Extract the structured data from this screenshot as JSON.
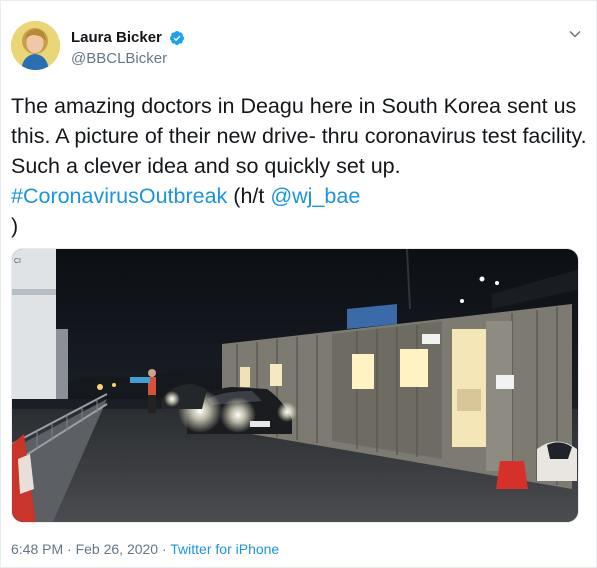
{
  "tweet": {
    "author": {
      "display_name": "Laura Bicker",
      "handle": "@BBCLBicker",
      "verified_icon": "verified-badge-icon"
    },
    "menu_icon": "chevron-down-icon",
    "text_part1": "The amazing doctors in Deagu here in South Korea sent us this. A picture of their new drive- thru coronavirus test facility. Such a clever idea and so quickly set up. ",
    "hashtag": "#CoronavirusOutbreak",
    "text_part2": " (h/t ",
    "mention": "@wj_bae",
    "text_part3": "\n)",
    "media": {
      "sign_text": "CI"
    },
    "timestamp": "6:48 PM · Feb 26, 2020 · ",
    "source": "Twitter for iPhone"
  },
  "colors": {
    "link": "#1b95e0",
    "verified": "#1da1f2",
    "text": "#14171a",
    "muted": "#657786"
  }
}
